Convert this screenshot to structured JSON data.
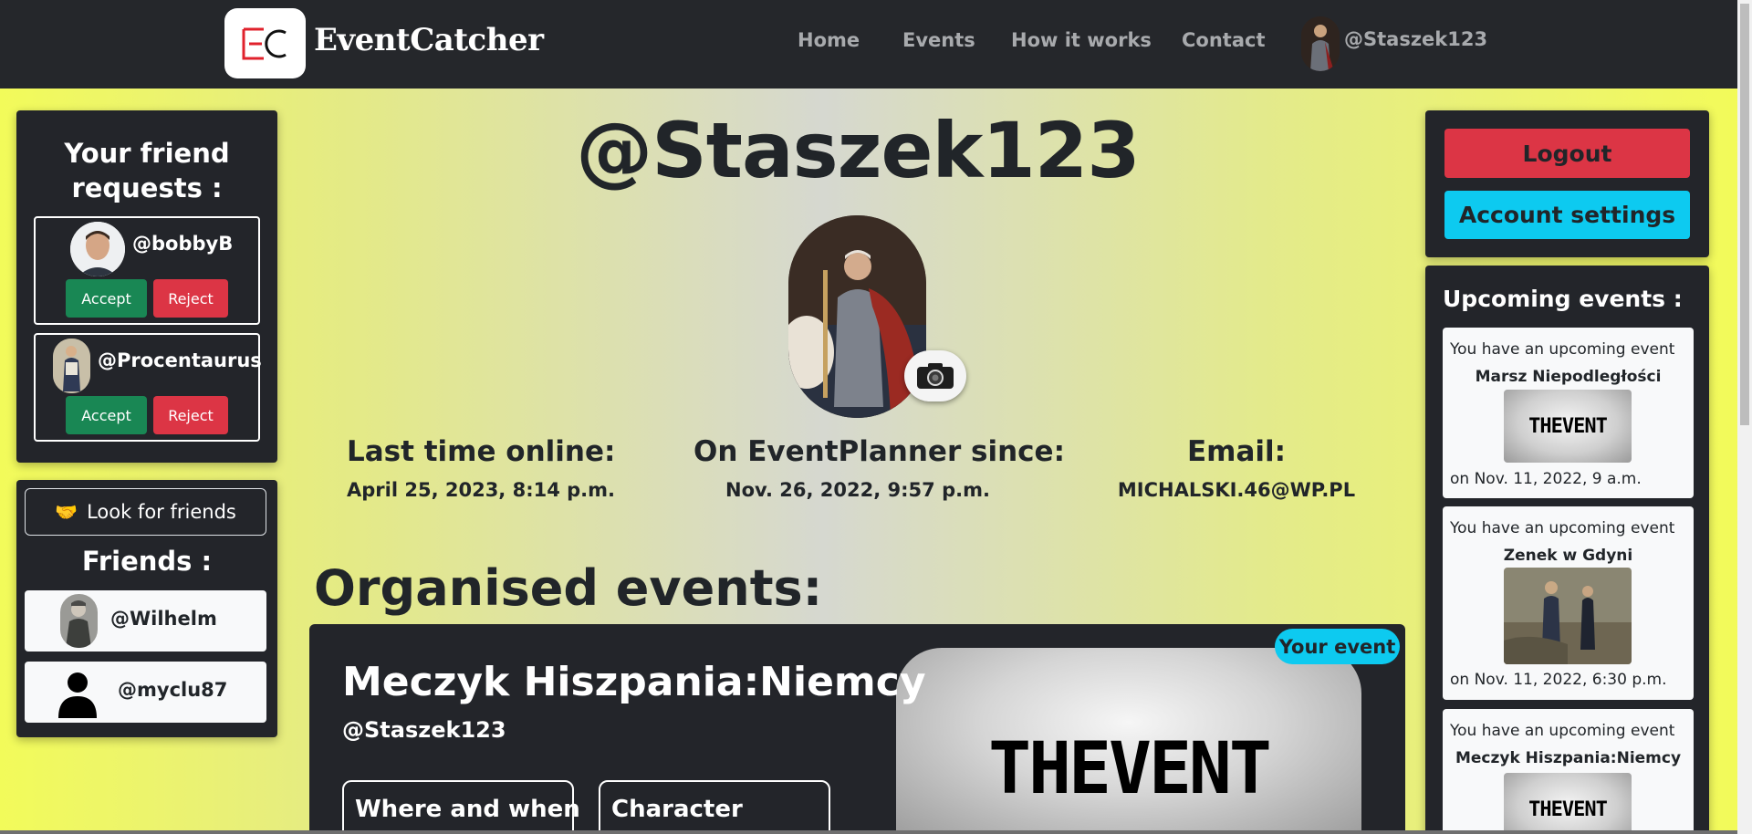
{
  "navbar": {
    "brand": "EventCatcher",
    "links": [
      "Home",
      "Events",
      "How it works",
      "Contact"
    ],
    "user": "@Staszek123"
  },
  "friend_requests": {
    "title": "Your friend requests :",
    "requests": [
      {
        "username": "@bobbyB",
        "accept": "Accept",
        "reject": "Reject"
      },
      {
        "username": "@Procentaurus",
        "accept": "Accept",
        "reject": "Reject"
      }
    ]
  },
  "friends": {
    "look_button": "Look for friends",
    "title": "Friends :",
    "list": [
      "@Wilhelm",
      "@myclu87"
    ]
  },
  "profile": {
    "username": "@Staszek123",
    "last_online_label": "Last time online:",
    "last_online_value": "April 25, 2023, 8:14 p.m.",
    "since_label": "On EventPlanner since:",
    "since_value": "Nov. 26, 2022, 9:57 p.m.",
    "email_label": "Email:",
    "email_value": "MICHALSKI.46@WP.PL"
  },
  "organised": {
    "title": "Organised events:",
    "event": {
      "badge": "Your event",
      "title": "Meczyk Hiszpania:Niemcy",
      "author": "@Staszek123",
      "box1": "Where and when",
      "box2": "Character",
      "image_text": "THEVENT"
    }
  },
  "account": {
    "logout": "Logout",
    "settings": "Account settings"
  },
  "upcoming": {
    "title": "Upcoming events :",
    "items": [
      {
        "intro": "You have an upcoming event",
        "name": "Marsz Niepodległości",
        "image_text": "THEVENT",
        "date": "on Nov. 11, 2022, 9 a.m."
      },
      {
        "intro": "You have an upcoming event",
        "name": "Zenek w Gdyni",
        "date": "on Nov. 11, 2022, 6:30 p.m."
      },
      {
        "intro": "You have an upcoming event",
        "name": "Meczyk Hiszpania:Niemcy",
        "image_text": "THEVENT"
      }
    ]
  },
  "colors": {
    "navbar": "#25272b",
    "accept": "#198754",
    "reject": "#dc3545",
    "info": "#0dcaf0"
  }
}
